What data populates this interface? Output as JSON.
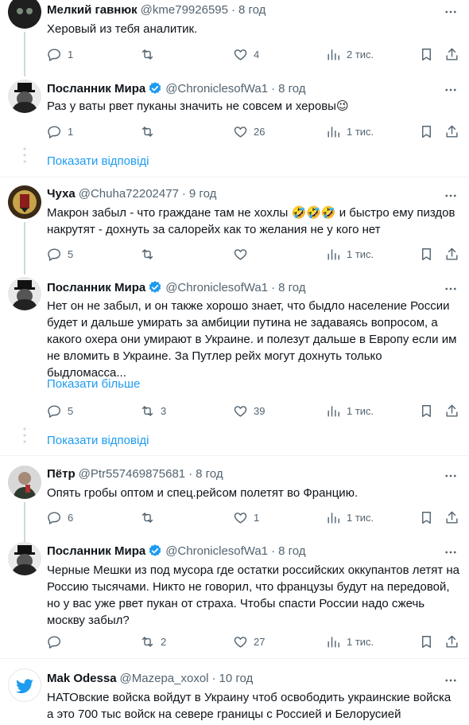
{
  "tweets": [
    {
      "name": "Мелкий гавнюк",
      "handle": "@kme79926595",
      "time": "8 год",
      "text": "Херовый из тебя аналитик.",
      "replies": "1",
      "retweets": "",
      "likes": "4",
      "views": "2 тис."
    },
    {
      "name": "Посланник Мира",
      "handle": "@ChroniclesofWa1",
      "time": "8 год",
      "text": "Раз у ваты рвет пуканы значить не совсем и херовы😉",
      "replies": "1",
      "retweets": "",
      "likes": "26",
      "views": "1 тис."
    },
    {
      "name": "Чуха",
      "handle": "@Chuha72202477",
      "time": "9 год",
      "text": "Макрон забыл - что граждане там не хохлы 🤣🤣🤣 и быстро ему пиздов накрутят - дохнуть за салорейх как то желания не у кого нет",
      "replies": "5",
      "retweets": "",
      "likes": "",
      "views": "1 тис."
    },
    {
      "name": "Посланник Мира",
      "handle": "@ChroniclesofWa1",
      "time": "8 год",
      "text": "Нет он не забыл, и он также хорошо знает, что быдло население России будет и дальше умирать за амбиции путина не задаваясь вопросом, а какого охера они умирают в Украине. и полезут дальше в Европу если им не вломить в Украине. За Путлер рейх могут дохнуть только быдломасса...",
      "show_more": "Показати більше",
      "replies": "5",
      "retweets": "3",
      "likes": "39",
      "views": "1 тис."
    },
    {
      "name": "Пётр",
      "handle": "@Ptr557469875681",
      "time": "8 год",
      "text": "Опять гробы оптом и спец.рейсом полетят во Францию.",
      "replies": "6",
      "retweets": "",
      "likes": "1",
      "views": "1 тис."
    },
    {
      "name": "Посланник Мира",
      "handle": "@ChroniclesofWa1",
      "time": "8 год",
      "text": "Черные Мешки из под мусора где остатки российских оккупантов летят на Россию тысячами. Никто не говорил, что французы будут на передовой, но у вас уже рвет пукан от страха. Чтобы спасти России надо сжечь москву  забыл?",
      "replies": "",
      "retweets": "2",
      "likes": "27",
      "views": "1 тис."
    },
    {
      "name": "Mak Odessa",
      "handle": "@Mazepa_xoxol",
      "time": "10 год",
      "text": "НАТОвские войска войдут в Украину чтоб освободить украинские войска а это 700 тыс войск на севере границы с Россией и Белорусией"
    }
  ],
  "show_replies_label": "Показати відповіді",
  "colors": {
    "accent": "#1d9bf0",
    "muted": "#536471",
    "divider": "#eff3f4"
  }
}
